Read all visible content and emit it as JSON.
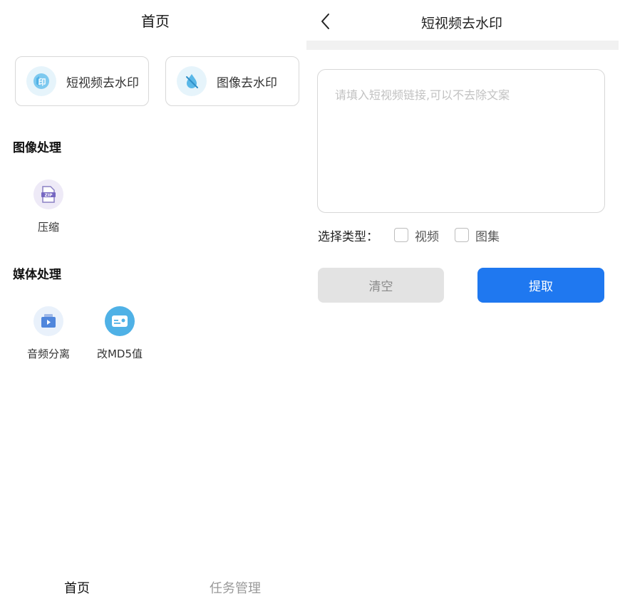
{
  "home": {
    "title": "首页",
    "tools": [
      {
        "label": "短视频去水印",
        "icon": "video-watermark-icon"
      },
      {
        "label": "图像去水印",
        "icon": "image-watermark-icon"
      }
    ],
    "sections": [
      {
        "title": "图像处理",
        "items": [
          {
            "label": "压缩",
            "icon": "zip-icon"
          }
        ]
      },
      {
        "title": "媒体处理",
        "items": [
          {
            "label": "音频分离",
            "icon": "audio-separate-icon"
          },
          {
            "label": "改MD5值",
            "icon": "md5-icon"
          }
        ]
      }
    ],
    "tabs": [
      {
        "label": "首页",
        "active": true
      },
      {
        "label": "任务管理",
        "active": false
      }
    ]
  },
  "extract": {
    "title": "短视频去水印",
    "input": {
      "placeholder": "请填入短视频链接,可以不去除文案",
      "value": ""
    },
    "type_label": "选择类型：",
    "options": [
      {
        "label": "视频",
        "checked": false
      },
      {
        "label": "图集",
        "checked": false
      }
    ],
    "clear_label": "清空",
    "extract_label": "提取"
  },
  "colors": {
    "primary": "#1f78f0",
    "clear_bg": "#e3e3e3",
    "icon_bg": "#e6f4fb",
    "tab_inactive": "#999999"
  }
}
